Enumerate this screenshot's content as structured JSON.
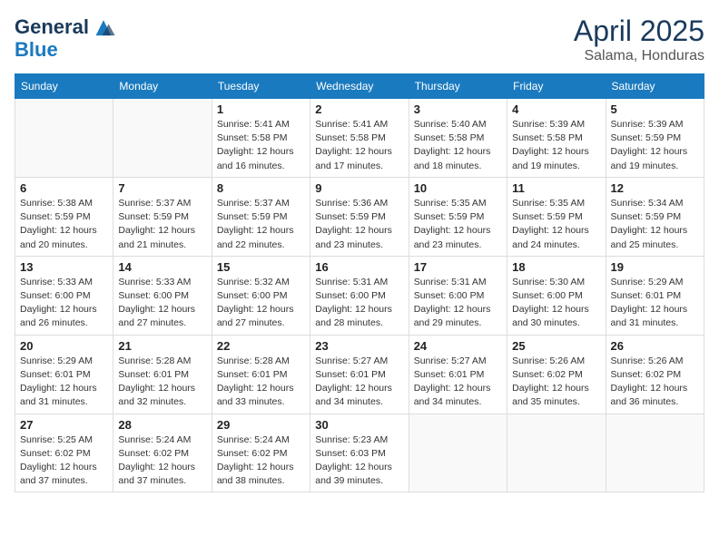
{
  "header": {
    "logo_line1": "General",
    "logo_line2": "Blue",
    "month": "April 2025",
    "location": "Salama, Honduras"
  },
  "weekdays": [
    "Sunday",
    "Monday",
    "Tuesday",
    "Wednesday",
    "Thursday",
    "Friday",
    "Saturday"
  ],
  "weeks": [
    [
      {
        "day": "",
        "info": ""
      },
      {
        "day": "",
        "info": ""
      },
      {
        "day": "1",
        "info": "Sunrise: 5:41 AM\nSunset: 5:58 PM\nDaylight: 12 hours and 16 minutes."
      },
      {
        "day": "2",
        "info": "Sunrise: 5:41 AM\nSunset: 5:58 PM\nDaylight: 12 hours and 17 minutes."
      },
      {
        "day": "3",
        "info": "Sunrise: 5:40 AM\nSunset: 5:58 PM\nDaylight: 12 hours and 18 minutes."
      },
      {
        "day": "4",
        "info": "Sunrise: 5:39 AM\nSunset: 5:58 PM\nDaylight: 12 hours and 19 minutes."
      },
      {
        "day": "5",
        "info": "Sunrise: 5:39 AM\nSunset: 5:59 PM\nDaylight: 12 hours and 19 minutes."
      }
    ],
    [
      {
        "day": "6",
        "info": "Sunrise: 5:38 AM\nSunset: 5:59 PM\nDaylight: 12 hours and 20 minutes."
      },
      {
        "day": "7",
        "info": "Sunrise: 5:37 AM\nSunset: 5:59 PM\nDaylight: 12 hours and 21 minutes."
      },
      {
        "day": "8",
        "info": "Sunrise: 5:37 AM\nSunset: 5:59 PM\nDaylight: 12 hours and 22 minutes."
      },
      {
        "day": "9",
        "info": "Sunrise: 5:36 AM\nSunset: 5:59 PM\nDaylight: 12 hours and 23 minutes."
      },
      {
        "day": "10",
        "info": "Sunrise: 5:35 AM\nSunset: 5:59 PM\nDaylight: 12 hours and 23 minutes."
      },
      {
        "day": "11",
        "info": "Sunrise: 5:35 AM\nSunset: 5:59 PM\nDaylight: 12 hours and 24 minutes."
      },
      {
        "day": "12",
        "info": "Sunrise: 5:34 AM\nSunset: 5:59 PM\nDaylight: 12 hours and 25 minutes."
      }
    ],
    [
      {
        "day": "13",
        "info": "Sunrise: 5:33 AM\nSunset: 6:00 PM\nDaylight: 12 hours and 26 minutes."
      },
      {
        "day": "14",
        "info": "Sunrise: 5:33 AM\nSunset: 6:00 PM\nDaylight: 12 hours and 27 minutes."
      },
      {
        "day": "15",
        "info": "Sunrise: 5:32 AM\nSunset: 6:00 PM\nDaylight: 12 hours and 27 minutes."
      },
      {
        "day": "16",
        "info": "Sunrise: 5:31 AM\nSunset: 6:00 PM\nDaylight: 12 hours and 28 minutes."
      },
      {
        "day": "17",
        "info": "Sunrise: 5:31 AM\nSunset: 6:00 PM\nDaylight: 12 hours and 29 minutes."
      },
      {
        "day": "18",
        "info": "Sunrise: 5:30 AM\nSunset: 6:00 PM\nDaylight: 12 hours and 30 minutes."
      },
      {
        "day": "19",
        "info": "Sunrise: 5:29 AM\nSunset: 6:01 PM\nDaylight: 12 hours and 31 minutes."
      }
    ],
    [
      {
        "day": "20",
        "info": "Sunrise: 5:29 AM\nSunset: 6:01 PM\nDaylight: 12 hours and 31 minutes."
      },
      {
        "day": "21",
        "info": "Sunrise: 5:28 AM\nSunset: 6:01 PM\nDaylight: 12 hours and 32 minutes."
      },
      {
        "day": "22",
        "info": "Sunrise: 5:28 AM\nSunset: 6:01 PM\nDaylight: 12 hours and 33 minutes."
      },
      {
        "day": "23",
        "info": "Sunrise: 5:27 AM\nSunset: 6:01 PM\nDaylight: 12 hours and 34 minutes."
      },
      {
        "day": "24",
        "info": "Sunrise: 5:27 AM\nSunset: 6:01 PM\nDaylight: 12 hours and 34 minutes."
      },
      {
        "day": "25",
        "info": "Sunrise: 5:26 AM\nSunset: 6:02 PM\nDaylight: 12 hours and 35 minutes."
      },
      {
        "day": "26",
        "info": "Sunrise: 5:26 AM\nSunset: 6:02 PM\nDaylight: 12 hours and 36 minutes."
      }
    ],
    [
      {
        "day": "27",
        "info": "Sunrise: 5:25 AM\nSunset: 6:02 PM\nDaylight: 12 hours and 37 minutes."
      },
      {
        "day": "28",
        "info": "Sunrise: 5:24 AM\nSunset: 6:02 PM\nDaylight: 12 hours and 37 minutes."
      },
      {
        "day": "29",
        "info": "Sunrise: 5:24 AM\nSunset: 6:02 PM\nDaylight: 12 hours and 38 minutes."
      },
      {
        "day": "30",
        "info": "Sunrise: 5:23 AM\nSunset: 6:03 PM\nDaylight: 12 hours and 39 minutes."
      },
      {
        "day": "",
        "info": ""
      },
      {
        "day": "",
        "info": ""
      },
      {
        "day": "",
        "info": ""
      }
    ]
  ]
}
